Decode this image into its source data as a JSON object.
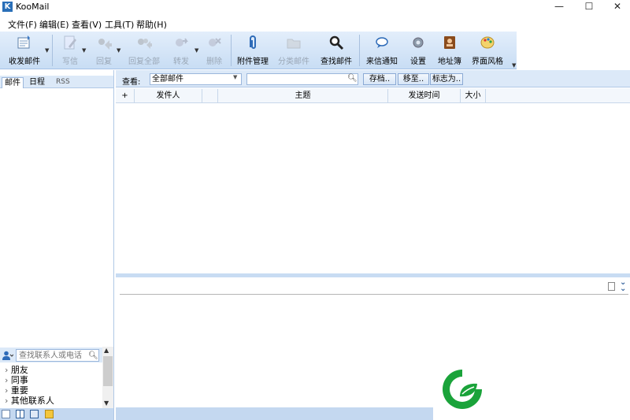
{
  "window": {
    "app_letter": "K",
    "title": "KooMail",
    "min": "—",
    "max": "☐",
    "close": "✕"
  },
  "menu": [
    "文件(F)",
    "编辑(E)",
    "查看(V)",
    "工具(T)",
    "帮助(H)"
  ],
  "toolbar": {
    "receive_send": "收发邮件",
    "compose": "写信",
    "reply": "回复",
    "reply_all": "回复全部",
    "forward": "转发",
    "delete": "删除",
    "attachments": "附件管理",
    "classify": "分类邮件",
    "find": "查找邮件",
    "notify": "来信通知",
    "settings": "设置",
    "address_book": "地址簿",
    "skin": "界面风格"
  },
  "left_tabs": [
    "邮件",
    "日程",
    "RSS"
  ],
  "contacts": {
    "search_placeholder": "查找联系人或电话",
    "groups": [
      "朋友",
      "同事",
      "重要",
      "其他联系人"
    ]
  },
  "filter": {
    "view_label": "查看:",
    "view_value": "全部邮件",
    "save_btn": "存档..",
    "move_btn": "移至..",
    "flag_btn": "标志为.."
  },
  "columns": [
    "+",
    "发件人",
    "主题",
    "发送时间",
    "大小"
  ],
  "colors": {
    "toolbar_top": "#e3eefb",
    "toolbar_bottom": "#c8ddf4",
    "accent_green": "#1aa33a"
  }
}
